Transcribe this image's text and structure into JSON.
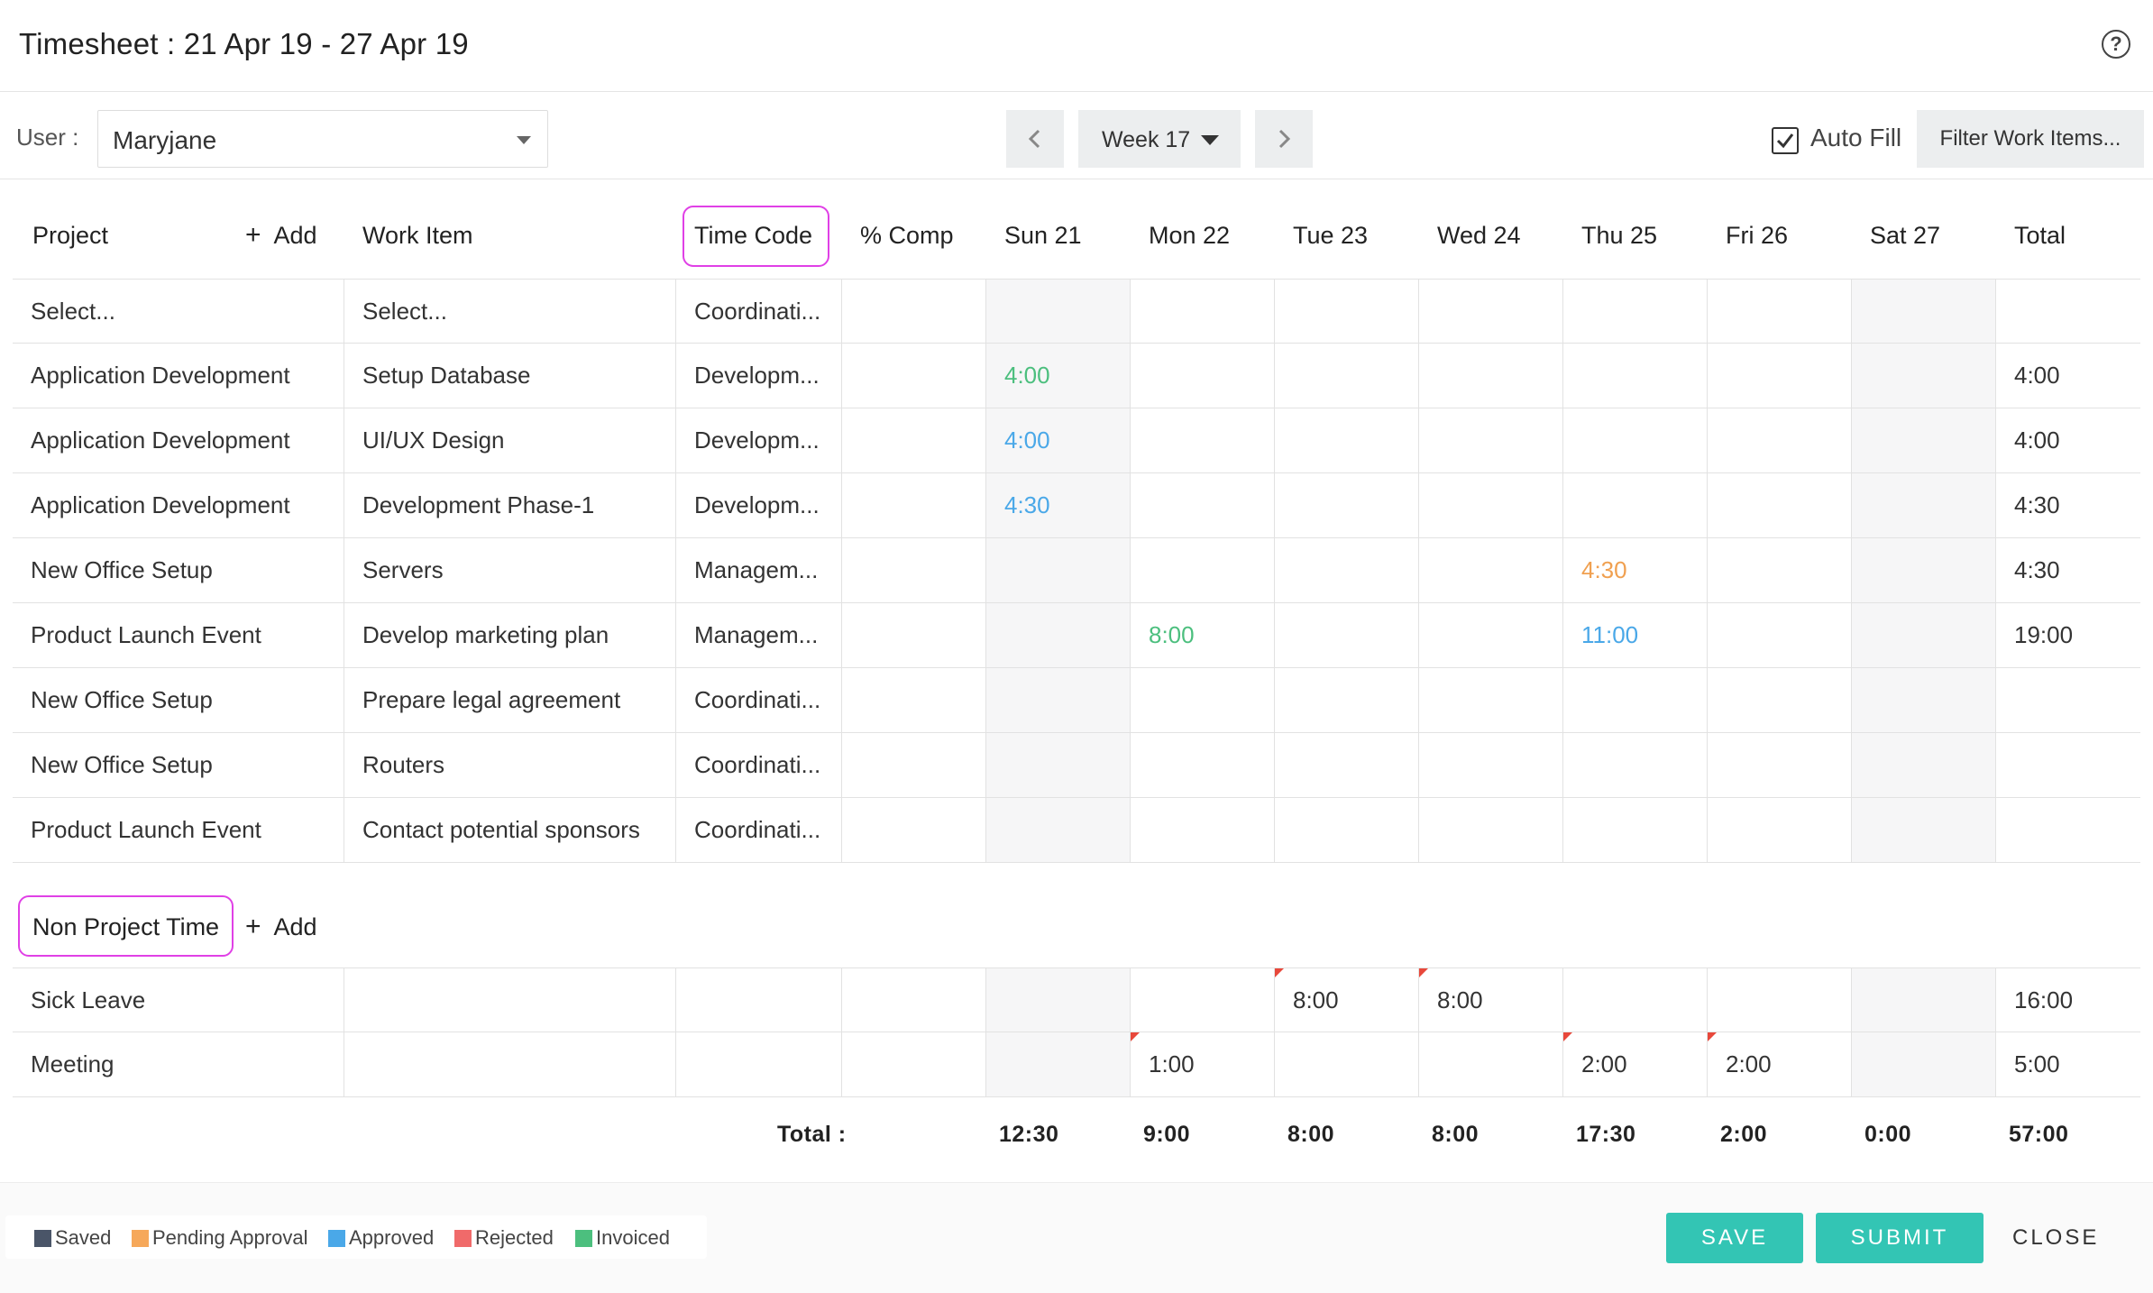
{
  "header": {
    "title": "Timesheet : 21 Apr 19 - 27 Apr 19",
    "help_icon": "help-circle-icon"
  },
  "toolbar": {
    "user_label": "User :",
    "user_value": "Maryjane",
    "week_value": "Week 17",
    "autofill_checked": true,
    "autofill_label": "Auto Fill",
    "filter_label": "Filter Work Items..."
  },
  "columns": {
    "project": "Project",
    "add": "Add",
    "work_item": "Work Item",
    "time_code": "Time Code",
    "comp": "% Comp",
    "days": [
      "Sun 21",
      "Mon 22",
      "Tue 23",
      "Wed 24",
      "Thu 25",
      "Fri 26",
      "Sat 27"
    ],
    "total": "Total"
  },
  "project_rows": [
    {
      "project": "Select...",
      "work_item": "Select...",
      "time_code": "Coordinati...",
      "days": [
        "",
        "",
        "",
        "",
        "",
        "",
        ""
      ],
      "total": ""
    },
    {
      "project": "Application Development",
      "work_item": "Setup Database",
      "time_code": "Developm...",
      "days": [
        "4:00",
        "",
        "",
        "",
        "",
        "",
        ""
      ],
      "total": "4:00"
    },
    {
      "project": "Application Development",
      "work_item": "UI/UX Design",
      "time_code": "Developm...",
      "days": [
        "4:00",
        "",
        "",
        "",
        "",
        "",
        ""
      ],
      "total": "4:00"
    },
    {
      "project": "Application Development",
      "work_item": "Development Phase-1",
      "time_code": "Developm...",
      "days": [
        "4:30",
        "",
        "",
        "",
        "",
        "",
        ""
      ],
      "total": "4:30"
    },
    {
      "project": "New Office Setup",
      "work_item": "Servers",
      "time_code": "Managem...",
      "days": [
        "",
        "",
        "",
        "",
        "4:30",
        "",
        ""
      ],
      "total": "4:30"
    },
    {
      "project": "Product Launch Event",
      "work_item": "Develop marketing plan",
      "time_code": "Managem...",
      "days": [
        "",
        "8:00",
        "",
        "",
        "11:00",
        "",
        ""
      ],
      "total": "19:00"
    },
    {
      "project": "New Office Setup",
      "work_item": "Prepare legal agreement",
      "time_code": "Coordinati...",
      "days": [
        "",
        "",
        "",
        "",
        "",
        "",
        ""
      ],
      "total": ""
    },
    {
      "project": "New Office Setup",
      "work_item": "Routers",
      "time_code": "Coordinati...",
      "days": [
        "",
        "",
        "",
        "",
        "",
        "",
        ""
      ],
      "total": ""
    },
    {
      "project": "Product Launch Event",
      "work_item": "Contact potential sponsors",
      "time_code": "Coordinati...",
      "days": [
        "",
        "",
        "",
        "",
        "",
        "",
        ""
      ],
      "total": ""
    }
  ],
  "non_project": {
    "title": "Non Project Time",
    "add": "Add",
    "rows": [
      {
        "name": "Sick Leave",
        "days": [
          "",
          "",
          "8:00",
          "8:00",
          "",
          "",
          ""
        ],
        "total": "16:00"
      },
      {
        "name": "Meeting",
        "days": [
          "",
          "1:00",
          "",
          "",
          "2:00",
          "2:00",
          ""
        ],
        "total": "5:00"
      }
    ]
  },
  "totals": {
    "label": "Total :",
    "days": [
      "12:30",
      "9:00",
      "8:00",
      "8:00",
      "17:30",
      "2:00",
      "0:00"
    ],
    "grand": "57:00"
  },
  "legend": [
    {
      "label": "Saved",
      "color": "#4a5568"
    },
    {
      "label": "Pending Approval",
      "color": "#f6a85a"
    },
    {
      "label": "Approved",
      "color": "#4aa8e8"
    },
    {
      "label": "Rejected",
      "color": "#f06a6a"
    },
    {
      "label": "Invoiced",
      "color": "#4cbf7e"
    }
  ],
  "status_colors": {
    "approved": "#4aa8e8",
    "invoiced": "#4cbf7e",
    "pending": "#f0a050"
  },
  "footer": {
    "save": "SAVE",
    "submit": "SUBMIT",
    "close": "CLOSE"
  }
}
